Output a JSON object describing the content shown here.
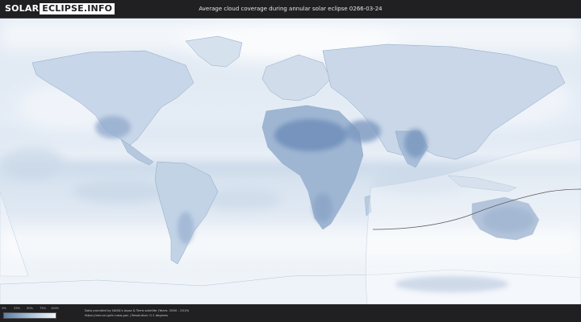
{
  "header": {
    "logo_left": "SOLAR",
    "logo_right": "ECLIPSE.INFO",
    "title": "Average cloud coverage during annular solar eclipse 0266-03-24"
  },
  "legend": {
    "ticks": [
      "0%",
      "25%",
      "50%",
      "75%",
      "100%"
    ],
    "colors": [
      "#5b7fa8",
      "#8eaacc",
      "#c2d3e6",
      "#f2f6fb"
    ]
  },
  "footer": {
    "credit_line_1": "Data provided by NASA's Aqua & Terra satellite (Years: 2000 - 2019)",
    "credit_line_2": "https://neo.sci.gsfc.nasa.gov | Resolution: 0.1 degrees"
  },
  "map": {
    "eclipse_path_color": "#555555",
    "ocean_color": "#e8eef5",
    "cloud_color": "#ffffff",
    "clear_land_color": "#6c8cb8"
  }
}
